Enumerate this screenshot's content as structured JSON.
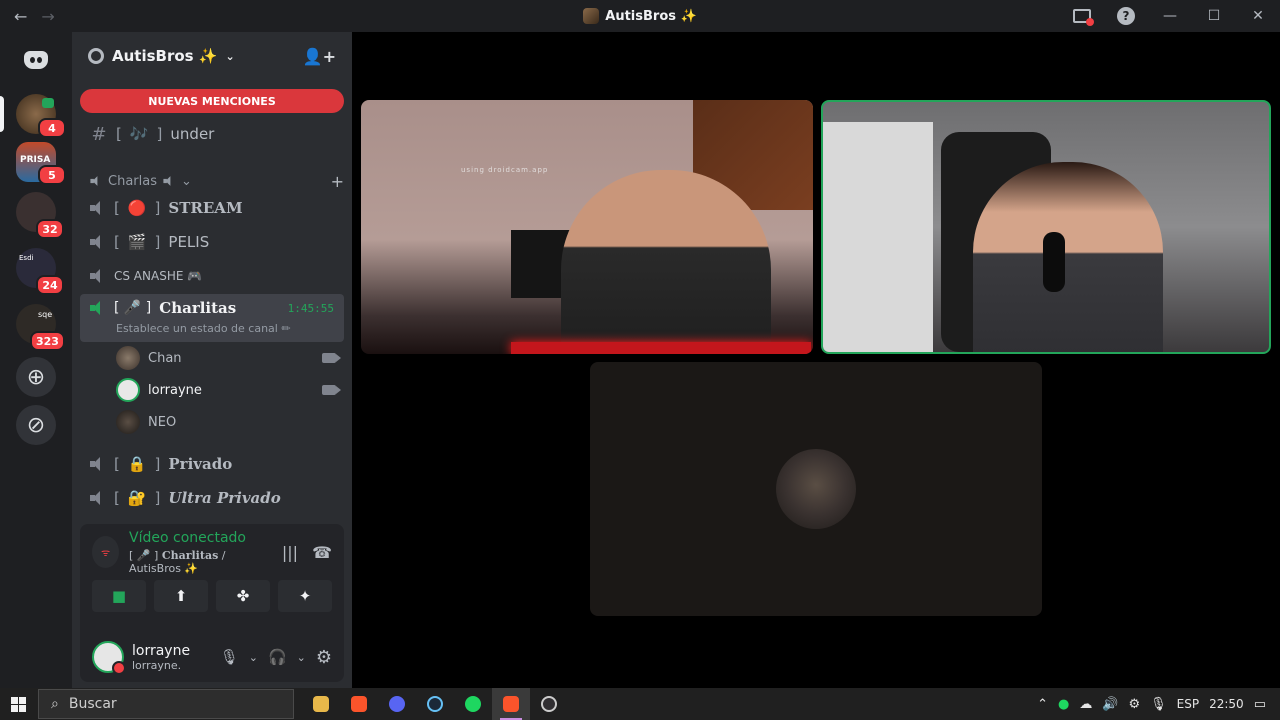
{
  "window": {
    "title": "AutisBros ✨"
  },
  "guilds": {
    "badges": [
      "4",
      "5",
      "32",
      "24",
      "323"
    ],
    "server_label_2": "PRISA",
    "server_label_3": "Esdi",
    "server_label_4": "sqe"
  },
  "server": {
    "name": "AutisBros ✨",
    "new_mentions": "NUEVAS MENCIONES"
  },
  "channels": {
    "text_channel": {
      "prefix": "[",
      "icon": "🎶",
      "suffix": "]",
      "name": "under"
    },
    "category": "Charlas",
    "voice": [
      {
        "name": "STREAM",
        "icon": "🔴"
      },
      {
        "name": "PELIS",
        "icon": "🎬"
      },
      {
        "name": "CS ANASHE 🎮"
      }
    ],
    "active": {
      "name": "Charlitas",
      "timer": "1:45:55",
      "status": "Establece un estado de canal ✏"
    },
    "members": [
      {
        "name": "Chan",
        "camera": true
      },
      {
        "name": "lorrayne",
        "camera": true
      },
      {
        "name": "NEO",
        "camera": false
      }
    ],
    "locked": [
      {
        "name": "Privado"
      },
      {
        "name": "Ultra Privado"
      }
    ]
  },
  "voice_panel": {
    "status": "Vídeo conectado",
    "location_channel": "Charlitas",
    "location_server": " / AutisBros ✨"
  },
  "user": {
    "display_name": "lorrayne",
    "username": "lorrayne."
  },
  "stage": {
    "watermark": "using droidcam.app"
  },
  "taskbar": {
    "search_placeholder": "Buscar",
    "language": "ESP",
    "time": "22:50"
  },
  "colors": {
    "accent_green": "#23a55a",
    "mention_red": "#da373c",
    "badge_red": "#f23f43"
  }
}
